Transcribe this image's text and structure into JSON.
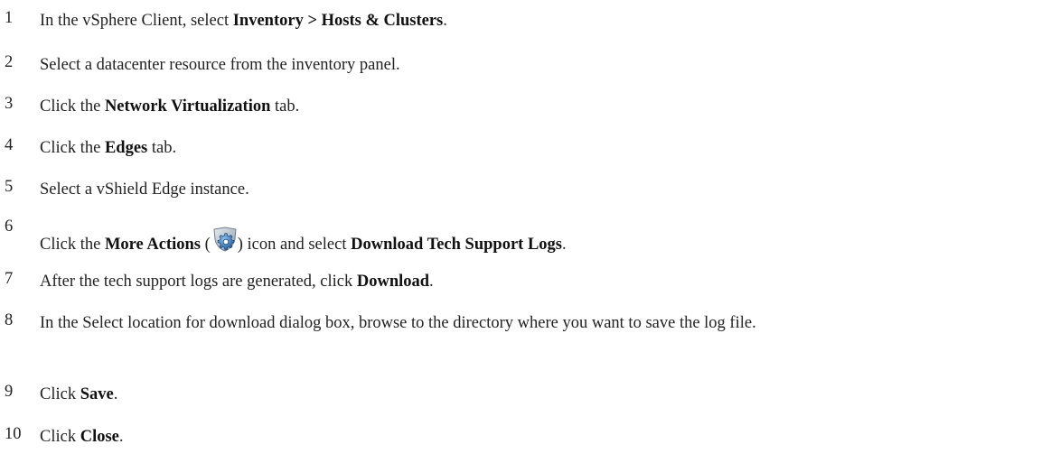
{
  "steps": [
    {
      "n": "1",
      "parts": [
        "In the vSphere Client, select ",
        "Inventory > Hosts & Clusters",
        "."
      ]
    },
    {
      "n": "2",
      "parts": [
        "Select a datacenter resource from the inventory panel."
      ]
    },
    {
      "n": "3",
      "parts": [
        "Click the ",
        "Network Virtualization",
        " tab."
      ]
    },
    {
      "n": "4",
      "parts": [
        "Click the ",
        "Edges",
        " tab."
      ]
    },
    {
      "n": "5",
      "parts": [
        "Select a vShield Edge instance."
      ]
    },
    {
      "n": "6",
      "parts": [
        "Click the ",
        "More Actions",
        " (",
        ") icon and select ",
        "Download Tech Support Logs",
        "."
      ],
      "icon": "more-actions-gear-icon"
    },
    {
      "n": "7",
      "parts": [
        "After the tech support logs are generated, click ",
        "Download",
        "."
      ]
    },
    {
      "n": "8",
      "parts": [
        "In the Select location for download dialog box, browse to the directory where you want to save the log file."
      ]
    },
    {
      "n": "9",
      "parts": [
        "Click ",
        "Save",
        "."
      ]
    },
    {
      "n": "10",
      "parts": [
        "Click ",
        "Close",
        "."
      ]
    }
  ]
}
